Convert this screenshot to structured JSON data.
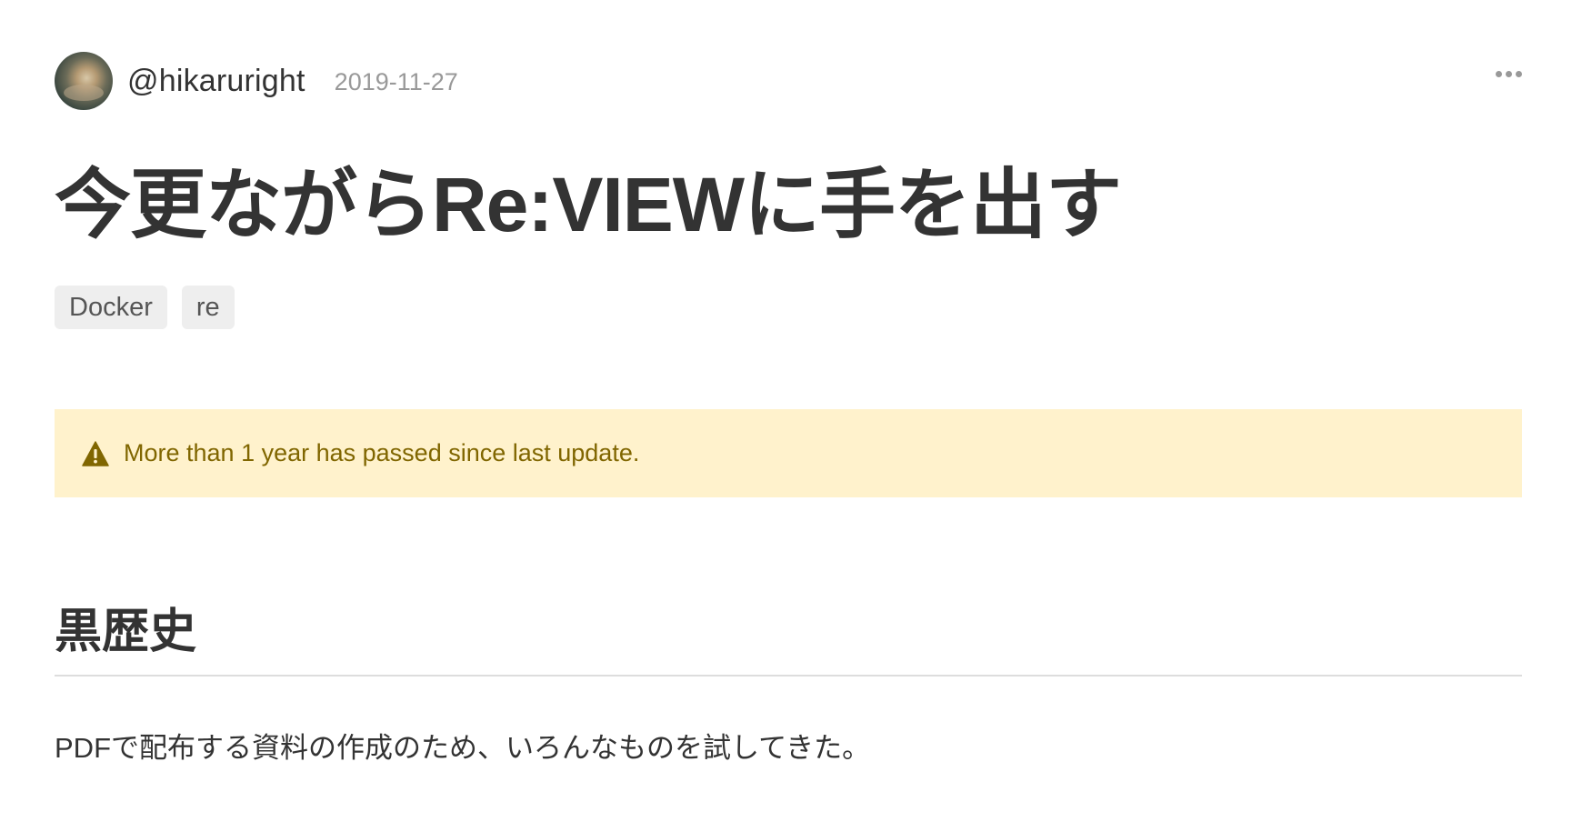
{
  "author": {
    "username": "@hikaruright",
    "date": "2019-11-27"
  },
  "article": {
    "title": "今更ながらRe:VIEWに手を出す",
    "tags": [
      "Docker",
      "re"
    ]
  },
  "alert": {
    "icon": "warning-icon",
    "message": "More than 1 year has passed since last update."
  },
  "body": {
    "heading": "黒歴史",
    "paragraph": "PDFで配布する資料の作成のため、いろんなものを試してきた。"
  },
  "colors": {
    "alert_background": "#fff2cc",
    "alert_text": "#806600",
    "tag_background": "#eeeeee",
    "text": "#333333",
    "muted": "#999999"
  }
}
